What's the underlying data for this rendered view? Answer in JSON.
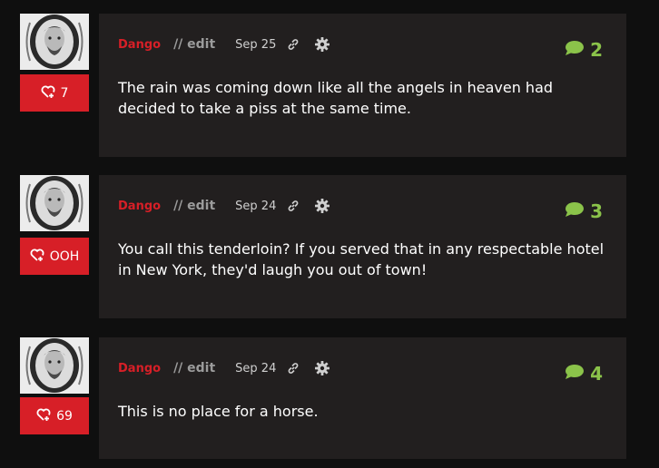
{
  "posts": [
    {
      "author": "Dango",
      "edit_label": "// edit",
      "date": "Sep 25",
      "comments": "2",
      "likes": "7",
      "text": "The rain was coming down like all the angels in heaven had decided to take a piss at the same time."
    },
    {
      "author": "Dango",
      "edit_label": "// edit",
      "date": "Sep 24",
      "comments": "3",
      "likes": "OOH",
      "text": "You call this tenderloin? If you served that in any respectable hotel in New York, they'd laugh you out of town!"
    },
    {
      "author": "Dango",
      "edit_label": "// edit",
      "date": "Sep 24",
      "comments": "4",
      "likes": "69",
      "text": "This is no place for a horse."
    }
  ],
  "icons": {
    "like": "heart-plus-icon",
    "link": "link-icon",
    "settings": "gear-icon",
    "comments": "speech-bubble-icon"
  },
  "colors": {
    "accent_red": "#d71f27",
    "comment_green": "#8bc34a",
    "card_bg": "#221f1f",
    "page_bg": "#0f0f0f"
  }
}
